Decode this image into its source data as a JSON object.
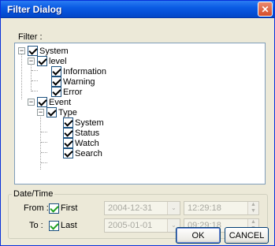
{
  "window": {
    "title": "Filter Dialog"
  },
  "filter": {
    "label": "Filter :",
    "tree": [
      {
        "label": "System",
        "checked": true
      },
      {
        "label": "level",
        "checked": true
      },
      {
        "label": "Information",
        "checked": true
      },
      {
        "label": "Warning",
        "checked": true
      },
      {
        "label": "Error",
        "checked": true
      },
      {
        "label": "Event",
        "checked": true
      },
      {
        "label": "Type",
        "checked": true
      },
      {
        "label": "System",
        "checked": true
      },
      {
        "label": "Status",
        "checked": true
      },
      {
        "label": "Watch",
        "checked": true
      },
      {
        "label": "Search",
        "checked": true
      }
    ],
    "expanders": {
      "system": "−",
      "level": "−",
      "event": "−",
      "type": "−"
    }
  },
  "datetime": {
    "label": "Date/Time",
    "from": {
      "label": "From :",
      "check_label": "First",
      "checked": true,
      "date": "2004-12-31",
      "time": "12:29:18"
    },
    "to": {
      "label": "To :",
      "check_label": "Last",
      "checked": true,
      "date": "2005-01-01",
      "time": "09:29:18"
    }
  },
  "buttons": {
    "ok": "OK",
    "cancel": "CANCEL",
    "close": "✕"
  },
  "icons": {
    "combo_arrow": "⌄",
    "spin_up": "▲",
    "spin_down": "▼"
  }
}
